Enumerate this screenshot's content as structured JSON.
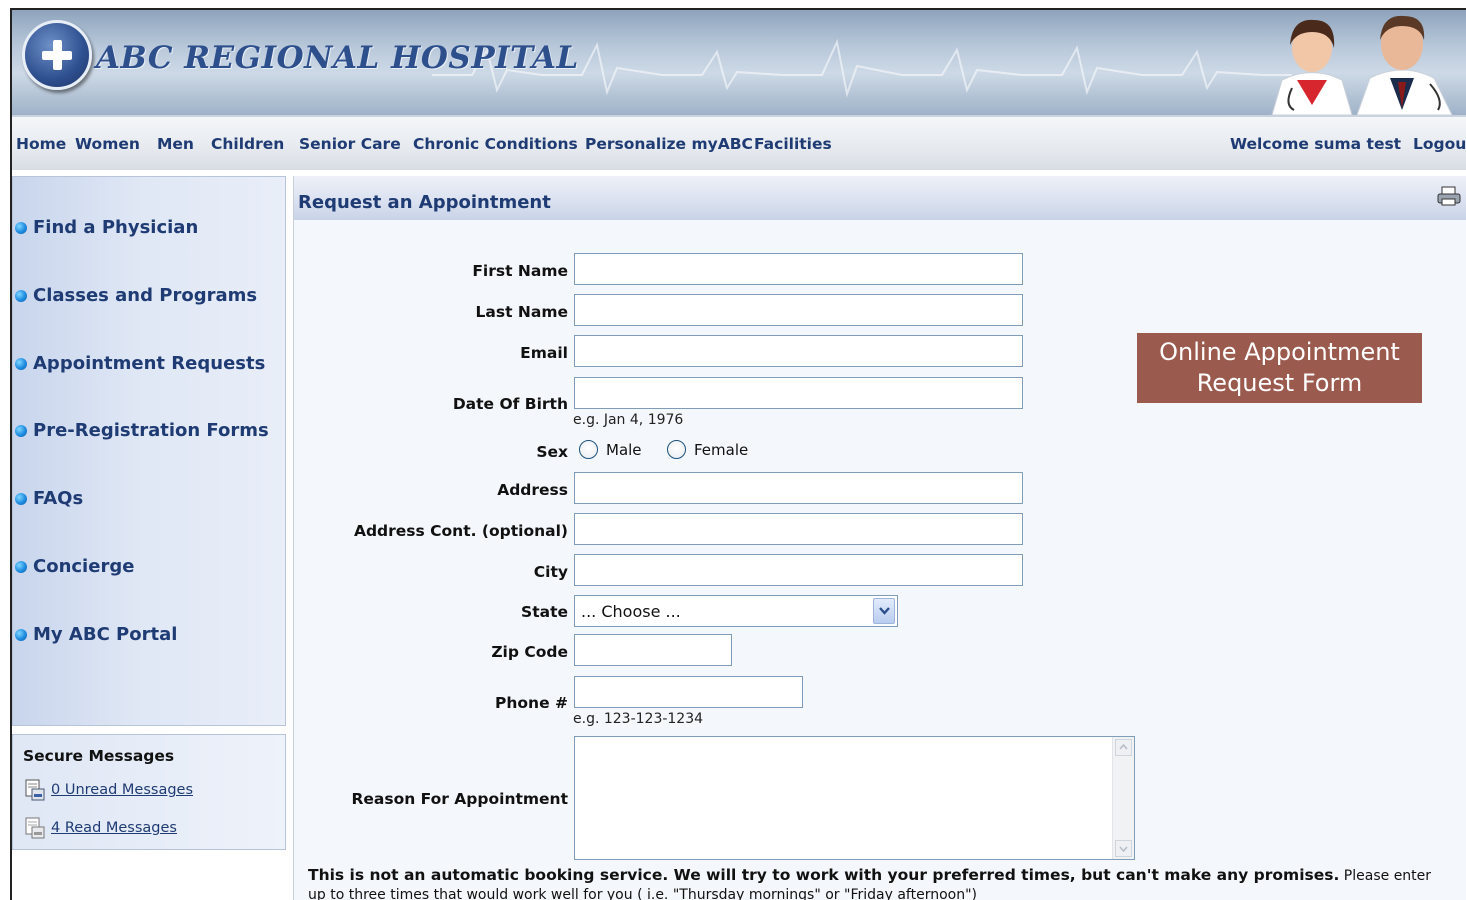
{
  "brand": {
    "name": "ABC REGIONAL HOSPITAL"
  },
  "nav": {
    "items": [
      "Home",
      "Women",
      "Men",
      "Children",
      "Senior Care",
      "Chronic Conditions",
      "Personalize myABC",
      "Facilities"
    ],
    "welcome": "Welcome suma test",
    "logout": "Logout"
  },
  "sidebar": {
    "items": [
      "Find a Physician",
      "Classes and Programs",
      "Appointment Requests",
      "Pre-Registration Forms",
      "FAQs",
      "Concierge",
      "My ABC Portal"
    ]
  },
  "messages": {
    "title": "Secure Messages",
    "unread": "0 Unread Messages",
    "read": "4 Read Messages"
  },
  "form": {
    "heading": "Request an Appointment",
    "first_name": "First Name",
    "last_name": "Last Name",
    "email": "Email",
    "dob": "Date Of Birth",
    "dob_hint": "e.g. Jan 4, 1976",
    "sex": "Sex",
    "male": "Male",
    "female": "Female",
    "address": "Address",
    "address2": "Address Cont. (optional)",
    "city": "City",
    "state": "State",
    "state_value": "... Choose ...",
    "zip": "Zip Code",
    "phone": "Phone #",
    "phone_hint": "e.g. 123-123-1234",
    "reason": "Reason For Appointment",
    "notice_bold": "This is not an automatic booking service. We will try to work with your preferred times, but can't make any promises.",
    "notice_rest": " Please enter up to three times that would work well for you ( i.e. \"Thursday mornings\" or \"Friday afternoon\")"
  },
  "promo": {
    "line1": "Online Appointment",
    "line2": "Request Form"
  },
  "colors": {
    "nav_text": "#1f3b73",
    "promo_bg": "#9b5a4e",
    "input_border": "#7f9db9"
  }
}
